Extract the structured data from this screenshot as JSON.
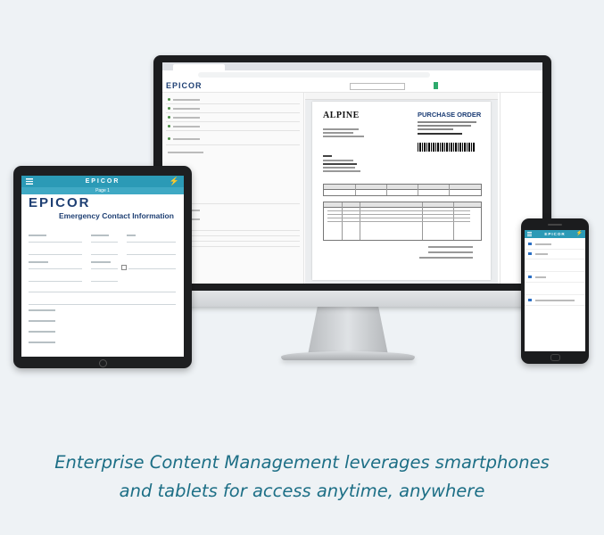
{
  "monitor": {
    "app_logo": "EPICOR",
    "document": {
      "vendor_logo": "ALPINE",
      "title": "PURCHASE ORDER"
    }
  },
  "tablet": {
    "brand": "EPICOR",
    "subheader": "Page 1",
    "logo": "EPICOR",
    "form_title": "Emergency Contact Information"
  },
  "phone": {
    "brand": "EPICOR"
  },
  "caption": {
    "line1": "Enterprise Content Management leverages smartphones",
    "line2": "and tablets for access anytime, anywhere"
  },
  "colors": {
    "background": "#eef2f5",
    "caption_text": "#1d6f86",
    "app_header": "#2b9ab6",
    "brand_navy": "#1e3f73",
    "device_bezel": "#1c1d1f"
  },
  "icons": [
    "hamburger-menu-icon",
    "lightning-bolt-icon",
    "barcode-graphic"
  ]
}
